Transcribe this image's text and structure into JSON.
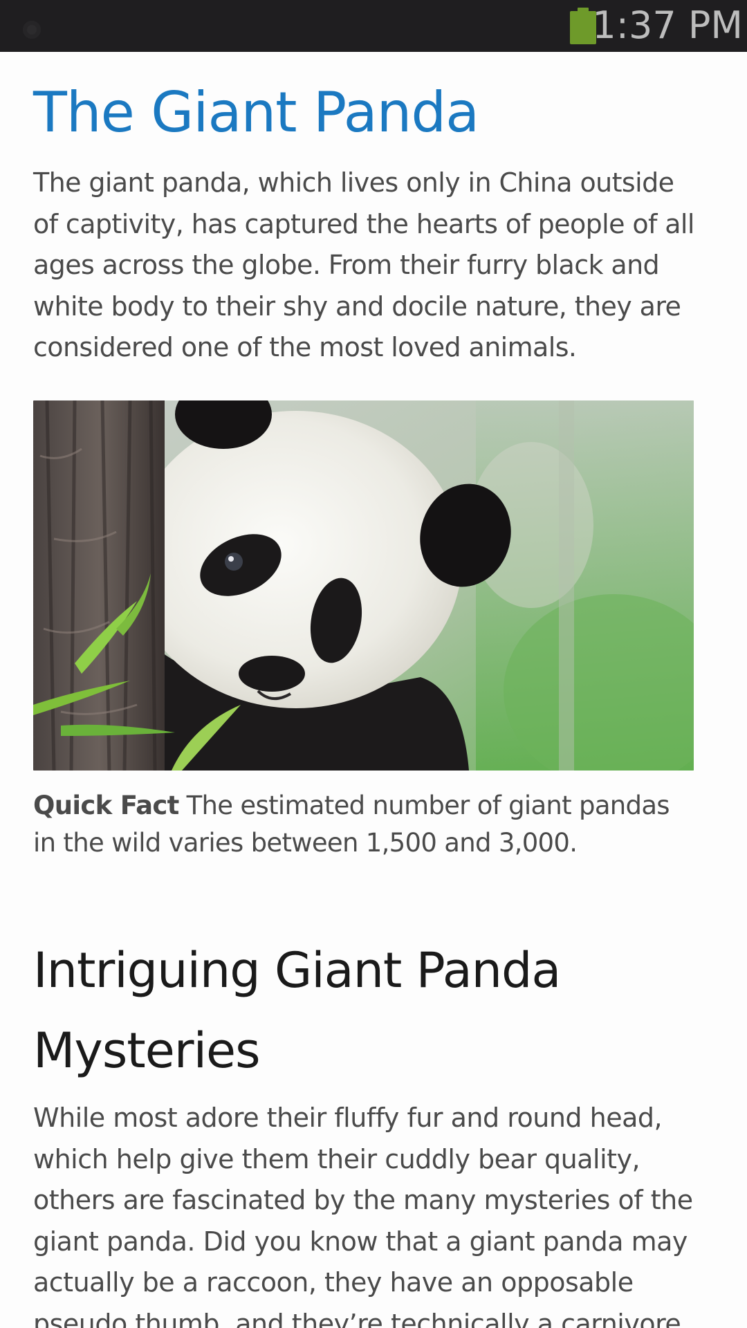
{
  "status_bar": {
    "time": "1:37 PM",
    "battery_color": "#6e9a2a",
    "icons": [
      "notification-dot-icon",
      "battery-icon"
    ]
  },
  "article": {
    "title": "The Giant Panda",
    "intro": "The giant panda, which lives only in China outside of captivity, has captured the hearts of people of all ages across the globe. From their furry black and white body to their shy and docile nature, they are considered one of the most loved animals.",
    "image": {
      "subject": "giant panda peeking from behind a tree trunk with bamboo leaves"
    },
    "quick_fact": {
      "label": "Quick Fact",
      "text": " The estimated number of giant pandas in the wild varies between 1,500 and 3,000."
    },
    "section_title": "Intriguing Giant Panda Mysteries",
    "section_body": "While most adore their fluffy fur and round head, which help give them their cuddly bear quality, others are fascinated by the many mysteries of the giant panda. Did you know that a giant panda may actually be a raccoon, they have an opposable pseudo thumb, and they’re technically a carnivore, but eat almost only bamboo?"
  },
  "colors": {
    "title": "#1b79c1",
    "body_text": "#4a4a4a",
    "status_bar_bg": "#1f1e20"
  }
}
